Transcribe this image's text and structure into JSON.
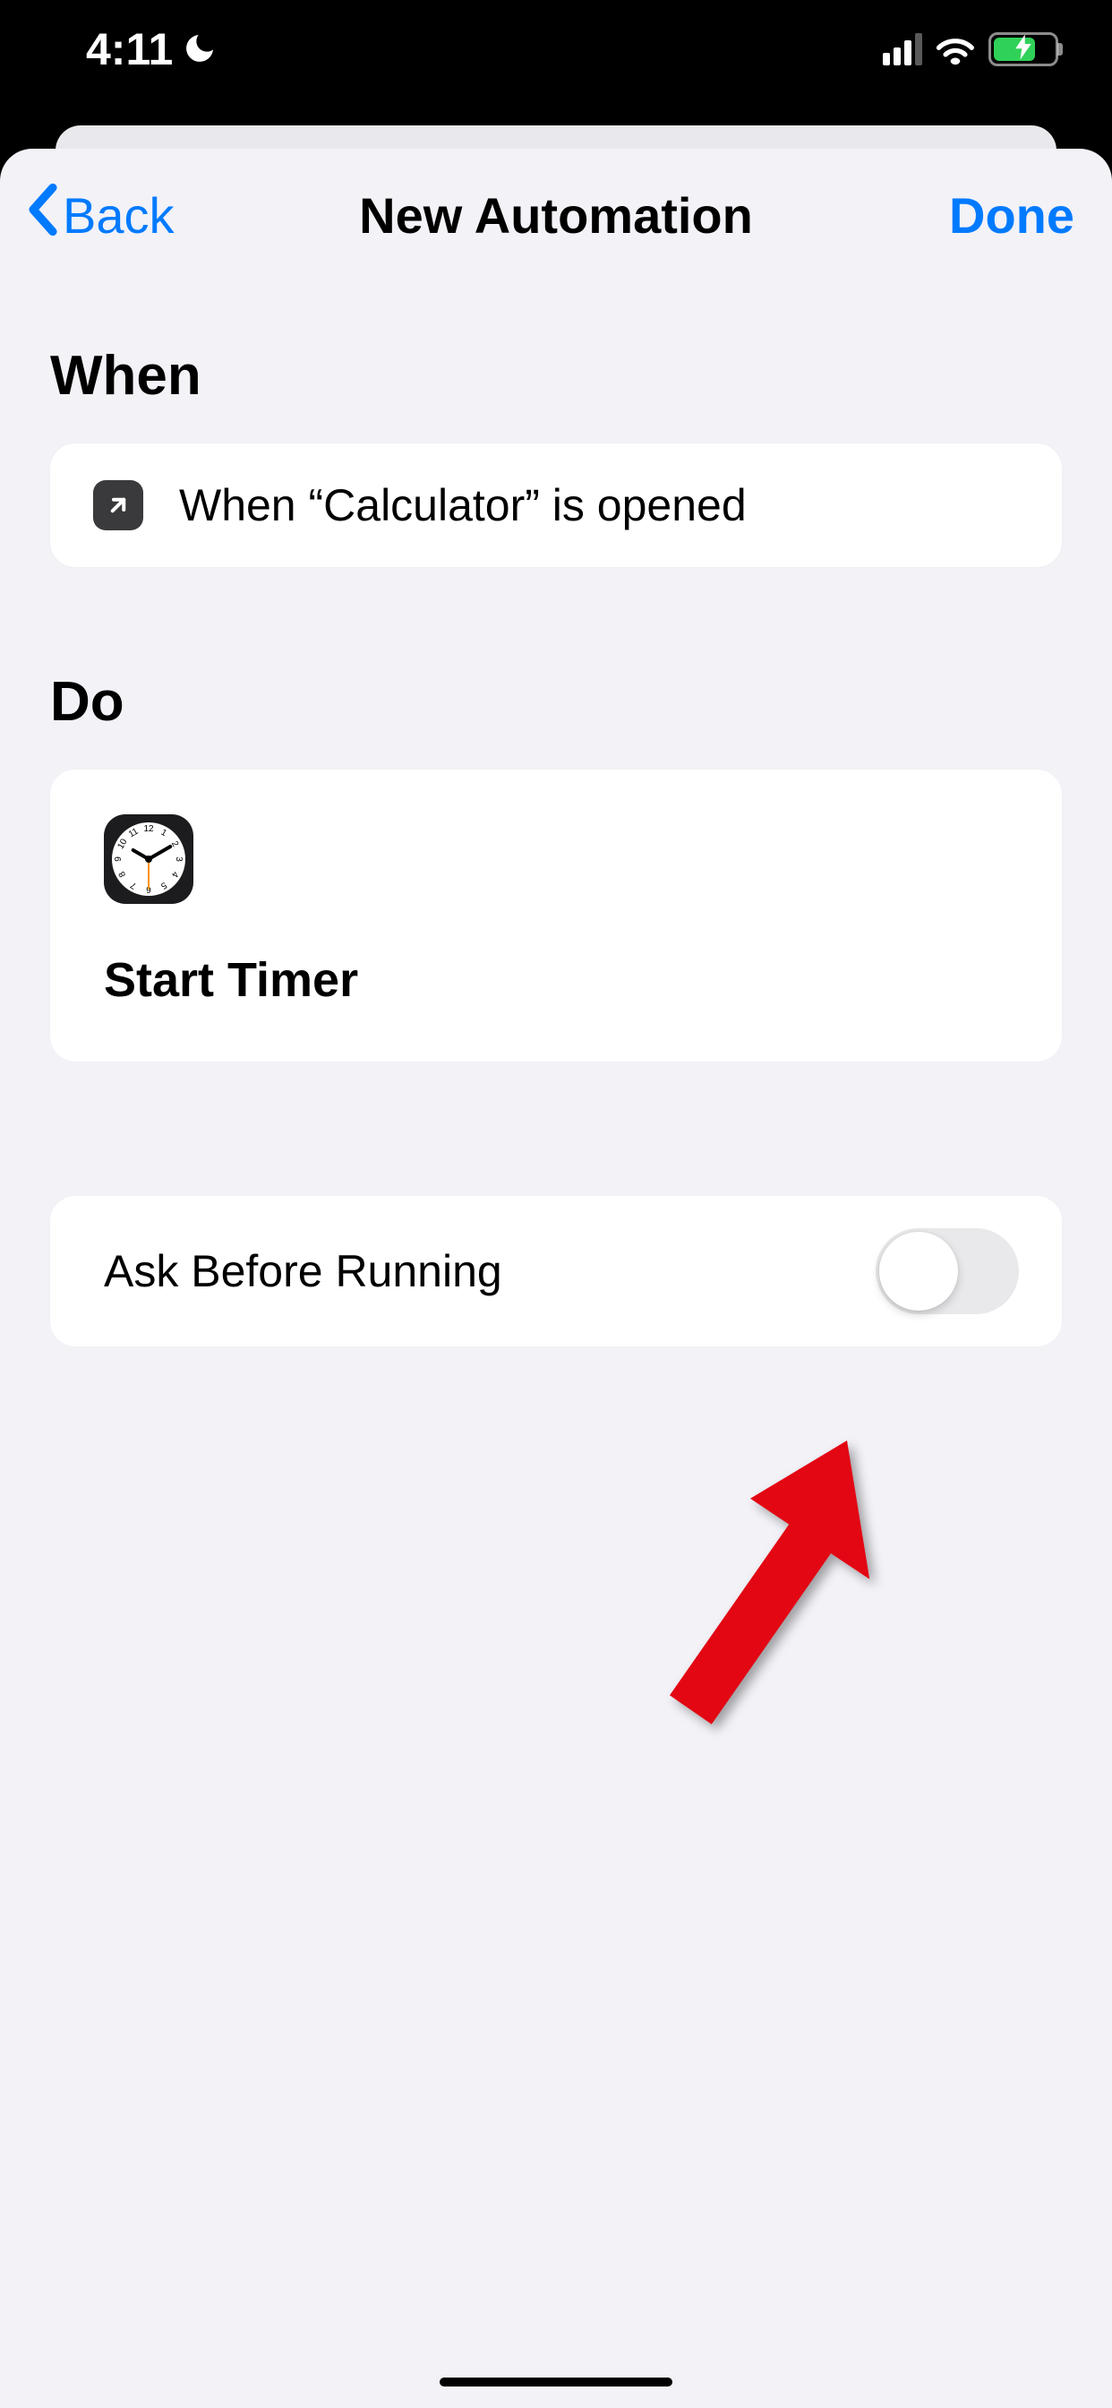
{
  "status": {
    "time": "4:11",
    "cellular_bars_active": 3,
    "battery_charging": true
  },
  "nav": {
    "back_label": "Back",
    "title": "New Automation",
    "done_label": "Done"
  },
  "sections": {
    "when_header": "When",
    "when_condition": "When “Calculator” is opened",
    "do_header": "Do",
    "do_action": "Start Timer"
  },
  "settings": {
    "ask_before_running_label": "Ask Before Running",
    "ask_before_running_value": false
  }
}
